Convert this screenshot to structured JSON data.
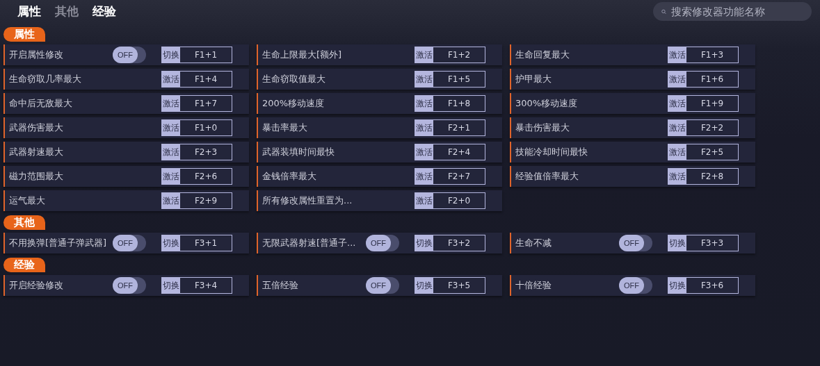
{
  "tabs": [
    {
      "label": "属性",
      "dimmed": false
    },
    {
      "label": "其他",
      "dimmed": true
    },
    {
      "label": "经验",
      "dimmed": false
    }
  ],
  "search": {
    "placeholder": "搜索修改器功能名称"
  },
  "sections": [
    {
      "title": "属性",
      "items": [
        {
          "label": "开启属性修改",
          "kind": "toggle",
          "on": false,
          "switch_label": "OFF",
          "action": "切换",
          "hotkey": "F1+1"
        },
        {
          "label": "生命上限最大[额外]",
          "kind": "button",
          "action": "激活",
          "hotkey": "F1+2"
        },
        {
          "label": "生命回复最大",
          "kind": "button",
          "action": "激活",
          "hotkey": "F1+3"
        },
        {
          "label": "生命窃取几率最大",
          "kind": "button",
          "action": "激活",
          "hotkey": "F1+4"
        },
        {
          "label": "生命窃取值最大",
          "kind": "button",
          "action": "激活",
          "hotkey": "F1+5"
        },
        {
          "label": "护甲最大",
          "kind": "button",
          "action": "激活",
          "hotkey": "F1+6"
        },
        {
          "label": "命中后无敌最大",
          "kind": "button",
          "action": "激活",
          "hotkey": "F1+7"
        },
        {
          "label": "200%移动速度",
          "kind": "button",
          "action": "激活",
          "hotkey": "F1+8"
        },
        {
          "label": "300%移动速度",
          "kind": "button",
          "action": "激活",
          "hotkey": "F1+9"
        },
        {
          "label": "武器伤害最大",
          "kind": "button",
          "action": "激活",
          "hotkey": "F1+0"
        },
        {
          "label": "暴击率最大",
          "kind": "button",
          "action": "激活",
          "hotkey": "F2+1"
        },
        {
          "label": "暴击伤害最大",
          "kind": "button",
          "action": "激活",
          "hotkey": "F2+2"
        },
        {
          "label": "武器射速最大",
          "kind": "button",
          "action": "激活",
          "hotkey": "F2+3"
        },
        {
          "label": "武器装填时间最快",
          "kind": "button",
          "action": "激活",
          "hotkey": "F2+4"
        },
        {
          "label": "技能冷却时间最快",
          "kind": "button",
          "action": "激活",
          "hotkey": "F2+5"
        },
        {
          "label": "磁力范围最大",
          "kind": "button",
          "action": "激活",
          "hotkey": "F2+6"
        },
        {
          "label": "金钱倍率最大",
          "kind": "button",
          "action": "激活",
          "hotkey": "F2+7"
        },
        {
          "label": "经验值倍率最大",
          "kind": "button",
          "action": "激活",
          "hotkey": "F2+8"
        },
        {
          "label": "运气最大",
          "kind": "button",
          "action": "激活",
          "hotkey": "F2+9"
        },
        {
          "label": "所有修改属性重置为...",
          "kind": "button",
          "action": "激活",
          "hotkey": "F2+0"
        }
      ]
    },
    {
      "title": "其他",
      "items": [
        {
          "label": "不用换弹[普通子弹武器]",
          "kind": "toggle",
          "on": false,
          "switch_label": "OFF",
          "action": "切换",
          "hotkey": "F3+1"
        },
        {
          "label": "无限武器射速[普通子...",
          "kind": "toggle",
          "on": false,
          "switch_label": "OFF",
          "action": "切换",
          "hotkey": "F3+2"
        },
        {
          "label": "生命不减",
          "kind": "toggle",
          "on": false,
          "switch_label": "OFF",
          "action": "切换",
          "hotkey": "F3+3"
        }
      ]
    },
    {
      "title": "经验",
      "items": [
        {
          "label": "开启经验修改",
          "kind": "toggle",
          "on": false,
          "switch_label": "OFF",
          "action": "切换",
          "hotkey": "F3+4"
        },
        {
          "label": "五倍经验",
          "kind": "toggle",
          "on": false,
          "switch_label": "OFF",
          "action": "切换",
          "hotkey": "F3+5"
        },
        {
          "label": "十倍经验",
          "kind": "toggle",
          "on": false,
          "switch_label": "OFF",
          "action": "切换",
          "hotkey": "F3+6"
        }
      ]
    }
  ]
}
